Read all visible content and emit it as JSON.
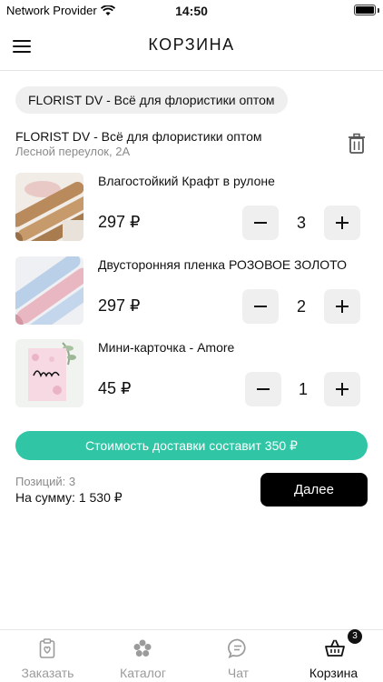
{
  "status_bar": {
    "carrier": "Network Provider",
    "time": "14:50"
  },
  "header": {
    "title": "КОРЗИНА",
    "menu_icon": "hamburger-menu-icon"
  },
  "store": {
    "chip_label": "FLORIST DV - Всё для флористики оптом",
    "name": "FLORIST DV - Всё для флористики оптом",
    "address": "Лесной переулок, 2А",
    "delete_icon": "trash-icon"
  },
  "cart_items": [
    {
      "title": "Влагостойкий Крафт в рулоне",
      "price": "297 ₽",
      "quantity": "3",
      "thumbnail": "kraft-paper-rolls"
    },
    {
      "title": "Двусторонняя пленка  РОЗОВОЕ ЗОЛОТО",
      "price": "297 ₽",
      "quantity": "2",
      "thumbnail": "pink-blue-film-rolls"
    },
    {
      "title": "Мини-карточка - Amore",
      "price": "45 ₽",
      "quantity": "1",
      "thumbnail": "amore-card"
    }
  ],
  "controls": {
    "decrement_symbol": "−",
    "increment_symbol": "+"
  },
  "delivery": {
    "text": "Стоимость доставки составит 350 ₽",
    "color": "#2fc5a5"
  },
  "summary": {
    "positions": "Позиций: 3",
    "total": "На сумму: 1 530 ₽",
    "next_label": "Далее"
  },
  "tab_bar": {
    "tabs": [
      {
        "label": "Заказать",
        "icon": "order-clipboard-icon",
        "active": false
      },
      {
        "label": "Каталог",
        "icon": "catalog-flower-icon",
        "active": false
      },
      {
        "label": "Чат",
        "icon": "chat-bubble-icon",
        "active": false
      },
      {
        "label": "Корзина",
        "icon": "basket-icon",
        "active": true
      }
    ],
    "cart_badge": "3"
  }
}
